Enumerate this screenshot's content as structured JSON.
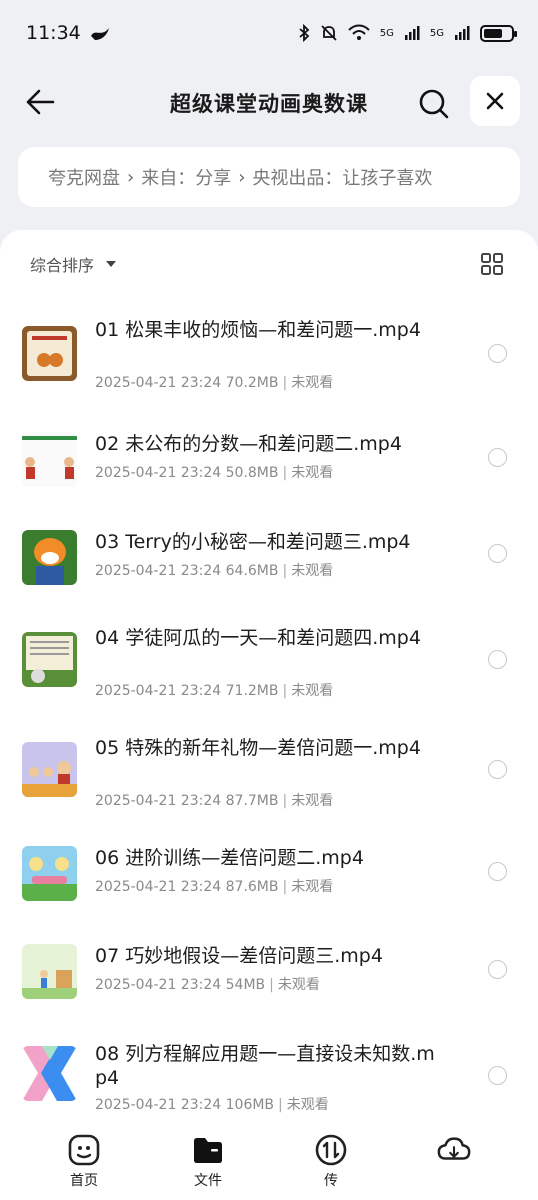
{
  "status": {
    "time": "11:34",
    "net1": "5G",
    "net2": "5G",
    "battery_level": 0.7
  },
  "header": {
    "title": "超级课堂动画奥数课"
  },
  "breadcrumb": {
    "items": [
      "夸克网盘",
      "来自：分享",
      "央视出品：让孩子喜欢"
    ]
  },
  "sort": {
    "label": "综合排序"
  },
  "files": [
    {
      "name": "01 松果丰收的烦恼—和差问题一.mp4",
      "date": "2025-04-21 23:24",
      "size": "70.2MB",
      "status": "未观看"
    },
    {
      "name": "02 未公布的分数—和差问题二.mp4",
      "date": "2025-04-21 23:24",
      "size": "50.8MB",
      "status": "未观看"
    },
    {
      "name": "03 Terry的小秘密—和差问题三.mp4",
      "date": "2025-04-21 23:24",
      "size": "64.6MB",
      "status": "未观看"
    },
    {
      "name": "04 学徒阿瓜的一天—和差问题四.mp4",
      "date": "2025-04-21 23:24",
      "size": "71.2MB",
      "status": "未观看"
    },
    {
      "name": "05 特殊的新年礼物—差倍问题一.mp4",
      "date": "2025-04-21 23:24",
      "size": "87.7MB",
      "status": "未观看"
    },
    {
      "name": "06 进阶训练—差倍问题二.mp4",
      "date": "2025-04-21 23:24",
      "size": "87.6MB",
      "status": "未观看"
    },
    {
      "name": "07 巧妙地假设—差倍问题三.mp4",
      "date": "2025-04-21 23:24",
      "size": "54MB",
      "status": "未观看"
    },
    {
      "name": "08 列方程解应用题一—直接设未知数.mp4",
      "date": "2025-04-21 23:24",
      "size": "106MB",
      "status": "未观看"
    }
  ],
  "nav": {
    "home": "首页",
    "files": "文件",
    "transfer": "传",
    "cloud": ""
  }
}
